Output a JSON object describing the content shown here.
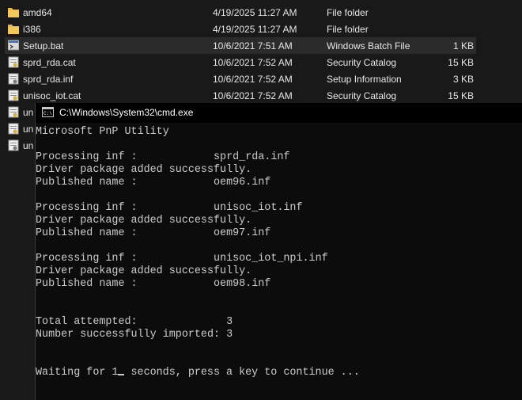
{
  "explorer": {
    "files": [
      {
        "name": "amd64",
        "date": "4/19/2025 11:27 AM",
        "type": "File folder",
        "size": "",
        "icon": "folder-icon"
      },
      {
        "name": "i386",
        "date": "4/19/2025 11:27 AM",
        "type": "File folder",
        "size": "",
        "icon": "folder-icon"
      },
      {
        "name": "Setup.bat",
        "date": "10/6/2021 7:51 AM",
        "type": "Windows Batch File",
        "size": "1 KB",
        "icon": "batch-file-icon"
      },
      {
        "name": "sprd_rda.cat",
        "date": "10/6/2021 7:52 AM",
        "type": "Security Catalog",
        "size": "15 KB",
        "icon": "security-catalog-icon"
      },
      {
        "name": "sprd_rda.inf",
        "date": "10/6/2021 7:52 AM",
        "type": "Setup Information",
        "size": "3 KB",
        "icon": "setup-information-icon"
      },
      {
        "name": "unisoc_iot.cat",
        "date": "10/6/2021 7:52 AM",
        "type": "Security Catalog",
        "size": "15 KB",
        "icon": "security-catalog-icon"
      },
      {
        "name": "un",
        "date": "",
        "type": "",
        "size": "",
        "icon": "security-catalog-icon"
      },
      {
        "name": "un",
        "date": "",
        "type": "",
        "size": "",
        "icon": "security-catalog-icon"
      },
      {
        "name": "un",
        "date": "",
        "type": "",
        "size": "",
        "icon": "setup-information-icon"
      }
    ]
  },
  "cmd": {
    "title": "C:\\Windows\\System32\\cmd.exe",
    "lines": [
      "Microsoft PnP Utility",
      "",
      "Processing inf :            sprd_rda.inf",
      "Driver package added successfully.",
      "Published name :            oem96.inf",
      "",
      "Processing inf :            unisoc_iot.inf",
      "Driver package added successfully.",
      "Published name :            oem97.inf",
      "",
      "Processing inf :            unisoc_iot_npi.inf",
      "Driver package added successfully.",
      "Published name :            oem98.inf",
      "",
      "",
      "Total attempted:              3",
      "Number successfully imported: 3",
      "",
      "",
      "Waiting for 1"
    ],
    "prompt_tail": " seconds, press a key to continue ..."
  },
  "colors": {
    "background": "#191919",
    "console_bg": "#0c0c0c",
    "console_text": "#cccccc",
    "folder": "#e8b84a",
    "selection": "#2b2b2b"
  }
}
